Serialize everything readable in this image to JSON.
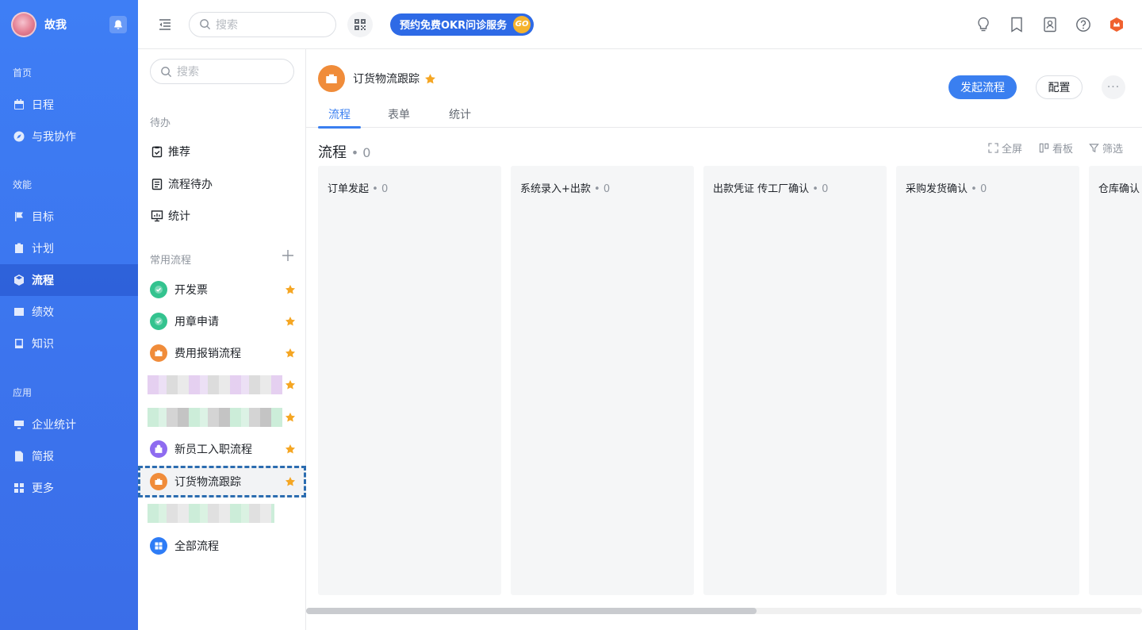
{
  "user": {
    "name": "故我"
  },
  "leftnav": {
    "sections": [
      {
        "label": "首页",
        "items": [
          {
            "label": "日程",
            "icon": "calendar-icon"
          },
          {
            "label": "与我协作",
            "icon": "compass-icon"
          }
        ]
      },
      {
        "label": "效能",
        "items": [
          {
            "label": "目标",
            "icon": "flag-icon"
          },
          {
            "label": "计划",
            "icon": "clipboard-icon"
          },
          {
            "label": "流程",
            "icon": "cube-icon",
            "active": true
          },
          {
            "label": "绩效",
            "icon": "chart-icon"
          },
          {
            "label": "知识",
            "icon": "book-icon"
          }
        ]
      },
      {
        "label": "应用",
        "items": [
          {
            "label": "企业统计",
            "icon": "monitor-icon"
          },
          {
            "label": "简报",
            "icon": "doc-icon"
          },
          {
            "label": "更多",
            "icon": "grid-icon"
          }
        ]
      }
    ]
  },
  "topbar": {
    "search_placeholder": "搜索",
    "promo_label": "预约免费OKR问诊服务",
    "promo_badge": "GO"
  },
  "subnav": {
    "search_placeholder": "搜索",
    "todo_section": "待办",
    "todo_items": [
      {
        "label": "推荐"
      },
      {
        "label": "流程待办"
      },
      {
        "label": "统计"
      }
    ],
    "common_section": "常用流程",
    "flows": [
      {
        "label": "开发票",
        "color": "#34c38f"
      },
      {
        "label": "用章申请",
        "color": "#34c38f"
      },
      {
        "label": "费用报销流程",
        "color": "#f08c3a"
      },
      {
        "label": "新员工入职流程",
        "color": "#8e6bf0"
      },
      {
        "label": "订货物流跟踪",
        "color": "#f08c3a"
      }
    ],
    "all_flows": "全部流程"
  },
  "main": {
    "process_title": "订货物流跟踪",
    "start_button": "发起流程",
    "config_button": "配置",
    "more_button": "···",
    "tabs": [
      {
        "label": "流程"
      },
      {
        "label": "表单"
      },
      {
        "label": "统计"
      }
    ],
    "board_title": "流程",
    "board_count": "• 0",
    "tools": {
      "fullscreen": "全屏",
      "kanban": "看板",
      "filter": "筛选"
    },
    "columns": [
      {
        "title": "订单发起",
        "count": "• 0"
      },
      {
        "title": "系统录入+出款",
        "count": "• 0"
      },
      {
        "title": "出款凭证 传工厂确认",
        "count": "• 0"
      },
      {
        "title": "采购发货确认",
        "count": "• 0"
      },
      {
        "title": "仓库确认",
        "count": ""
      }
    ]
  },
  "colors": {
    "nav_blue": "#3e7ef5",
    "primary": "#3a7ff0",
    "star": "#f5a623"
  }
}
